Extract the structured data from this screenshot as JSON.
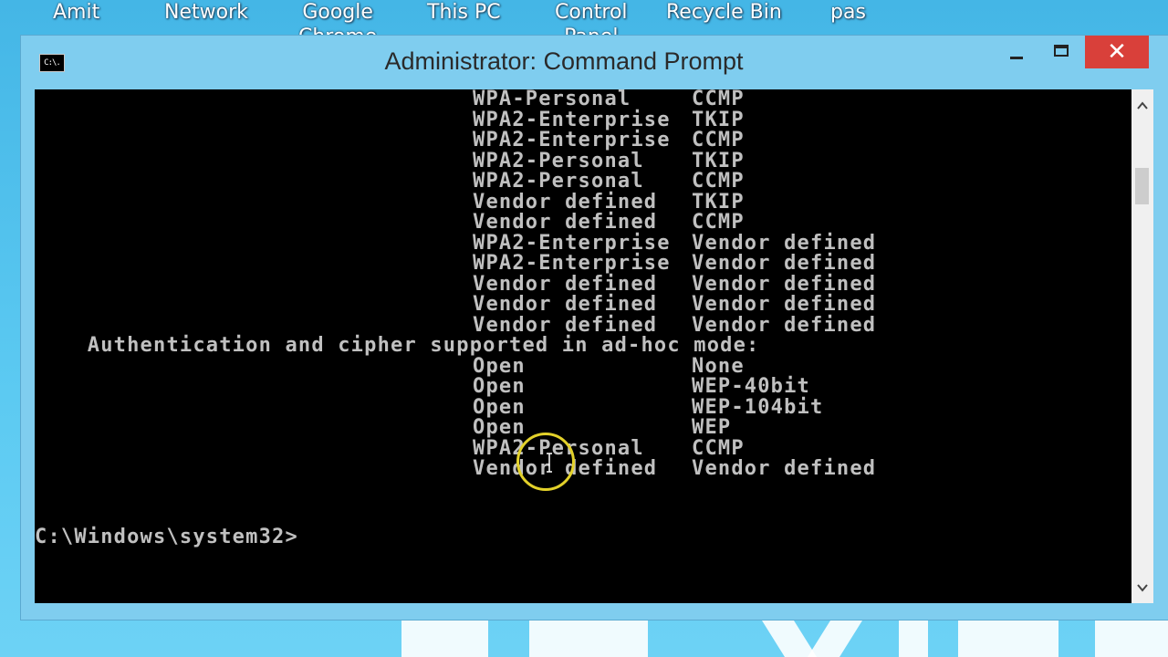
{
  "desktop": {
    "icons": [
      {
        "label": "Amit",
        "label2": ""
      },
      {
        "label": "Network",
        "label2": ""
      },
      {
        "label": "Google",
        "label2": "Chrome"
      },
      {
        "label": "This PC",
        "label2": ""
      },
      {
        "label": "Control",
        "label2": "Panel"
      },
      {
        "label": "Recycle Bin",
        "label2": ""
      },
      {
        "label": "pas",
        "label2": ""
      }
    ]
  },
  "window": {
    "title": "Administrator: Command Prompt",
    "app_icon_text": "C:\\.",
    "close_glyph": "✕"
  },
  "console": {
    "cipher_rows": [
      {
        "auth": "WPA-Personal",
        "cipher": "CCMP"
      },
      {
        "auth": "WPA2-Enterprise",
        "cipher": "TKIP"
      },
      {
        "auth": "WPA2-Enterprise",
        "cipher": "CCMP"
      },
      {
        "auth": "WPA2-Personal",
        "cipher": "TKIP"
      },
      {
        "auth": "WPA2-Personal",
        "cipher": "CCMP"
      },
      {
        "auth": "Vendor defined",
        "cipher": "TKIP"
      },
      {
        "auth": "Vendor defined",
        "cipher": "CCMP"
      },
      {
        "auth": "WPA2-Enterprise",
        "cipher": "Vendor defined"
      },
      {
        "auth": "WPA2-Enterprise",
        "cipher": "Vendor defined"
      },
      {
        "auth": "Vendor defined",
        "cipher": "Vendor defined"
      },
      {
        "auth": "Vendor defined",
        "cipher": "Vendor defined"
      },
      {
        "auth": "Vendor defined",
        "cipher": "Vendor defined"
      }
    ],
    "adhoc_heading": "    Authentication and cipher supported in ad-hoc mode:",
    "adhoc_rows": [
      {
        "auth": "Open",
        "cipher": "None"
      },
      {
        "auth": "Open",
        "cipher": "WEP-40bit"
      },
      {
        "auth": "Open",
        "cipher": "WEP-104bit"
      },
      {
        "auth": "Open",
        "cipher": "WEP"
      },
      {
        "auth": "WPA2-Personal",
        "cipher": "CCMP"
      },
      {
        "auth": "Vendor defined",
        "cipher": "Vendor defined"
      }
    ],
    "prompt": "C:\\Windows\\system32>"
  },
  "colors": {
    "console_bg": "#000000",
    "console_fg": "#c0c0c0",
    "titlebar_bg": "#7fcdef",
    "close_button": "#d9403a",
    "cursor_highlight": "#e3d12a"
  }
}
